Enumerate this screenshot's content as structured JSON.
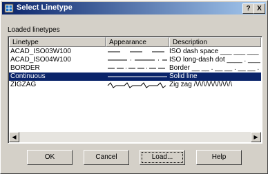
{
  "window": {
    "title": "Select Linetype",
    "help_label": "?",
    "close_label": "X"
  },
  "group_label": "Loaded linetypes",
  "table": {
    "headers": [
      "Linetype",
      "Appearance",
      "Description"
    ],
    "rows": [
      {
        "name": "ACAD_ISO03W100",
        "description": "ISO dash space ___ ___ ___",
        "pattern": "dash-space",
        "selected": false
      },
      {
        "name": "ACAD_ISO04W100",
        "description": "ISO long-dash dot ____ . ____",
        "pattern": "longdash-dot",
        "selected": false
      },
      {
        "name": "BORDER",
        "description": "Border __ __ . __ __ . __ __ .",
        "pattern": "border",
        "selected": false
      },
      {
        "name": "Continuous",
        "description": "Solid line",
        "pattern": "solid",
        "selected": true
      },
      {
        "name": "ZIGZAG",
        "description": "Zig zag /\\/\\/\\/\\/\\/\\/\\/\\/\\/\\",
        "pattern": "zigzag",
        "selected": false
      }
    ]
  },
  "buttons": {
    "ok": "OK",
    "cancel": "Cancel",
    "load": "Load...",
    "help": "Help"
  },
  "colors": {
    "title_start": "#0a246a",
    "title_end": "#a6caf0",
    "selection": "#0a246a",
    "face": "#d4d0c8"
  },
  "icons": {
    "app": "autocad-dialog-icon",
    "help": "question-mark-icon",
    "close": "close-icon"
  }
}
